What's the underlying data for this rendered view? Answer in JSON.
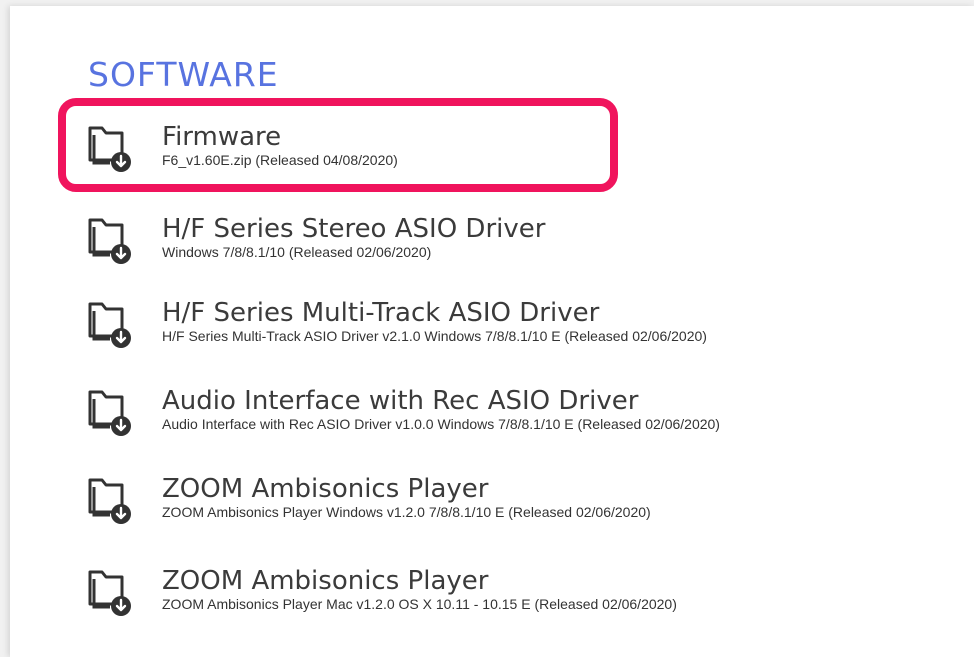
{
  "section": {
    "title": "SOFTWARE"
  },
  "colors": {
    "section_title": "#5873e0",
    "highlight": "#f0145d",
    "text": "#3b3b3b"
  },
  "items": [
    {
      "icon": "folder-download-icon",
      "title": "Firmware",
      "subtitle": "F6_v1.60E.zip (Released 04/08/2020)",
      "highlighted": true
    },
    {
      "icon": "folder-download-icon",
      "title": "H/F Series Stereo ASIO Driver",
      "subtitle": "Windows 7/8/8.1/10 (Released 02/06/2020)"
    },
    {
      "icon": "folder-download-icon",
      "title": "H/F Series Multi-Track ASIO Driver",
      "subtitle": "H/F Series Multi-Track ASIO Driver v2.1.0 Windows 7/8/8.1/10 E (Released 02/06/2020)"
    },
    {
      "icon": "folder-download-icon",
      "title": "Audio Interface with Rec ASIO Driver",
      "subtitle": "Audio Interface with Rec ASIO Driver v1.0.0 Windows 7/8/8.1/10 E (Released 02/06/2020)"
    },
    {
      "icon": "folder-download-icon",
      "title": "ZOOM Ambisonics Player",
      "subtitle": "ZOOM Ambisonics Player Windows v1.2.0 7/8/8.1/10 E (Released 02/06/2020)"
    },
    {
      "icon": "folder-download-icon",
      "title": "ZOOM Ambisonics Player",
      "subtitle": "ZOOM Ambisonics Player Mac v1.2.0 OS X 10.11 - 10.15 E (Released 02/06/2020)"
    }
  ]
}
